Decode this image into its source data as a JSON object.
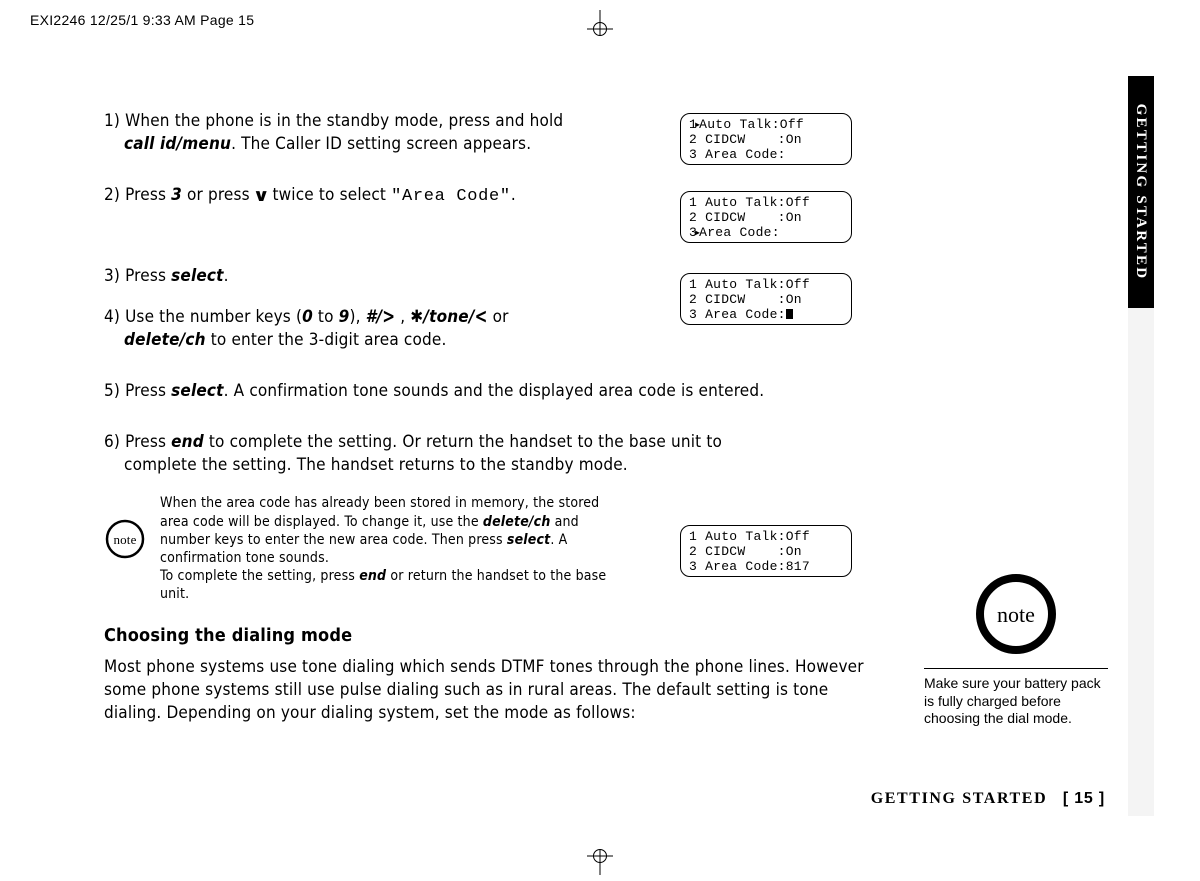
{
  "header": "EXI2246  12/25/1 9:33 AM  Page 15",
  "section_tab": "GETTING STARTED",
  "steps": {
    "s1a": "1) When the phone is in the standby mode, press and hold",
    "s1b_key": "call id/menu",
    "s1b_rest": ". The Caller ID setting screen appears.",
    "s2a": "2) Press ",
    "s2b_key": "3",
    "s2c": " or press ",
    "s2d_rest": " twice to select ",
    "s2e_lcd": "\"Area Code\"",
    "s2f": ".",
    "s3a": "3) Press ",
    "s3b_key": "select",
    "s3c": ".",
    "s4a": "4) Use the number keys (",
    "s4b0": "0",
    "s4b_mid": " to ",
    "s4b9": "9",
    "s4c": "), ",
    "s4d_key": "#/",
    "s4e": " , ",
    "s4f_star": "✱",
    "s4f_key": "/tone/",
    "s4g": " or",
    "s4h_key": "delete/ch",
    "s4h_rest": " to enter the 3-digit area code.",
    "s5a": "5) Press ",
    "s5b_key": "select",
    "s5c": ". A confirmation tone sounds and the displayed area code is entered.",
    "s6a": "6) Press ",
    "s6b_key": "end",
    "s6c": " to complete the setting. Or return the handset to the base unit to",
    "s6d": "complete the setting. The handset returns to the standby mode."
  },
  "note_inline": {
    "p1": "When the area code has already been stored in memory, the stored area code will be displayed. To change it, use the ",
    "k1": "delete/ch",
    "p2": " and number keys to enter the new area code. Then press ",
    "k2": "select",
    "p3": ". A confirmation tone sounds.",
    "p4": "To complete the setting, press ",
    "k3": "end",
    "p5": " or return the handset to the base unit."
  },
  "note_label": "note",
  "subheading": "Choosing the dialing mode",
  "paragraph": "Most phone systems use tone dialing which sends DTMF tones through the phone lines. However some phone systems still use pulse dialing such as in rural areas. The default setting is tone dialing. Depending on your dialing system, set the mode as follows:",
  "side_note": "Make sure your battery pack is fully charged before choosing the dial mode.",
  "lcd": {
    "a1": "1",
    "a1b": "Auto Talk:Off",
    "a2": "2 CIDCW    :On",
    "a3": "3 Area Code:",
    "b1": "1 Auto Talk:Off",
    "b2": "2 CIDCW    :On",
    "b3n": "3",
    "b3t": "Area Code:",
    "c1": "1 Auto Talk:Off",
    "c2": "2 CIDCW    :On",
    "c3": "3 Area Code:",
    "d1": "1 Auto Talk:Off",
    "d2": "2 CIDCW    :On",
    "d3": "3 Area Code:817"
  },
  "footer": {
    "section": "GETTING STARTED",
    "page": "[ 15 ]"
  }
}
